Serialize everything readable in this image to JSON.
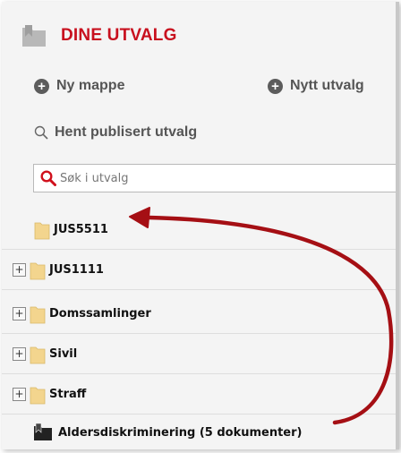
{
  "header": {
    "title": "DINE UTVALG",
    "icon": "saved-selection-icon"
  },
  "actions": {
    "new_folder": "Ny mappe",
    "new_selection": "Nytt utvalg",
    "fetch_published": "Hent publisert utvalg"
  },
  "search": {
    "placeholder": "Søk i utvalg"
  },
  "folders": [
    {
      "label": "JUS5511",
      "expandable": false
    },
    {
      "label": "JUS1111",
      "expandable": true
    },
    {
      "label": "Domssamlinger",
      "expandable": true
    },
    {
      "label": "Sivil",
      "expandable": true
    },
    {
      "label": "Straff",
      "expandable": true
    }
  ],
  "selection": {
    "label": "Aldersdiskriminering (5 dokumenter)"
  },
  "colors": {
    "title": "#c8101e",
    "arrow": "#a50f14",
    "folder": "#f3d58e",
    "search_icon": "#d0101c"
  }
}
